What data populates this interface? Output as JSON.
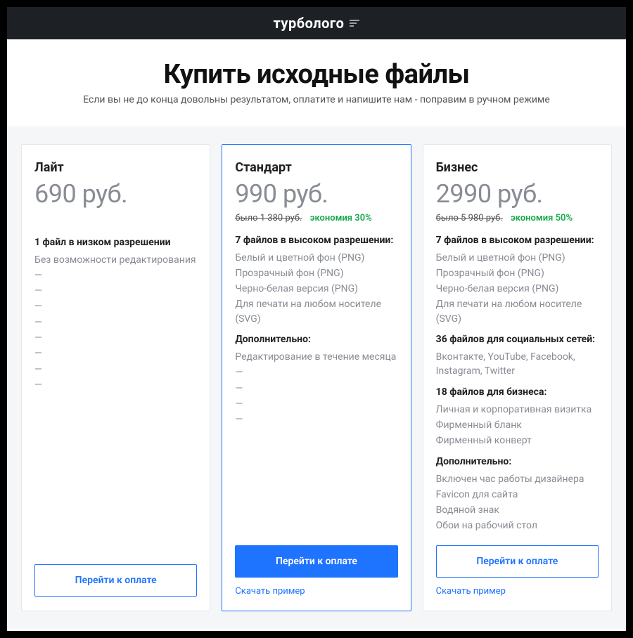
{
  "header": {
    "logo_text": "турболого"
  },
  "hero": {
    "title": "Купить исходные файлы",
    "subtitle": "Если вы не до конца довольны результатом, оплатите и напишите нам - поправим в ручном режиме"
  },
  "common": {
    "buy_label": "Перейти к оплате",
    "sample_label": "Скачать пример",
    "dash": "—"
  },
  "plans": {
    "lite": {
      "name": "Лайт",
      "price": "690 руб.",
      "section1_head": "1 файл в низком разрешении",
      "section1_items": [
        "Без возможности редактирования",
        "—",
        "—",
        "—",
        "—",
        "—",
        "—",
        "—",
        "—"
      ]
    },
    "standard": {
      "name": "Стандарт",
      "price": "990 руб.",
      "old_price": "было 1 380 руб.",
      "savings": "экономия 30%",
      "section1_head": "7 файлов в высоком разрешении:",
      "section1_items": [
        "Белый и цветной фон (PNG)",
        "Прозрачный фон (PNG)",
        "Черно-белая версия (PNG)",
        "Для печати на любом носителе (SVG)"
      ],
      "section2_head": "Дополнительно:",
      "section2_items": [
        "Редактирование в течение месяца",
        "—",
        "—",
        "—",
        "—"
      ]
    },
    "business": {
      "name": "Бизнес",
      "price": "2990 руб.",
      "old_price": "было 5 980 руб.",
      "savings": "экономия 50%",
      "section1_head": "7 файлов в высоком разрешении:",
      "section1_items": [
        "Белый и цветной фон (PNG)",
        "Прозрачный фон (PNG)",
        "Черно-белая версия (PNG)",
        "Для печати на любом носителе (SVG)"
      ],
      "section2_head": "36 файлов для социальных сетей:",
      "section2_items": [
        "Вконтакте, YouTube, Facebook, Instagram, Twitter"
      ],
      "section3_head": "18 файлов для бизнеса:",
      "section3_items": [
        "Личная и корпоративная визитка",
        "Фирменный бланк",
        "Фирменный конверт"
      ],
      "section4_head": "Дополнительно:",
      "section4_items": [
        "Включен час работы дизайнера",
        "Favicon для сайта",
        "Водяной знак",
        "Обои на рабочий стол"
      ]
    }
  }
}
